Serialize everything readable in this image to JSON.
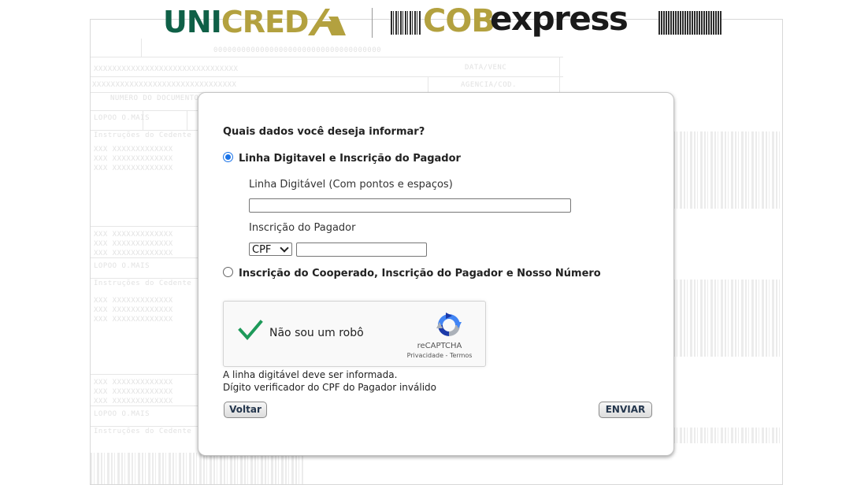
{
  "header": {
    "brand_left_part1": "UNI",
    "brand_left_part2": "CRED",
    "brand_right_part1": "COB",
    "brand_right_part2": "express"
  },
  "background": {
    "row1": "000000000000000000000000000000000000",
    "row2": "XXXXXXXXXXXXXXXXXXXXXXXXXXXXXXX",
    "row3": "DATA/VENC",
    "row4": "AGENCIA/COD.",
    "row5": "NUMERO DO DOCUMENTO",
    "row6": "LOPOO        O.MAIS",
    "row7": "XXX XXXXXXXXXXXXX",
    "row8": "Instruções do Cedente"
  },
  "form": {
    "question": "Quais dados você deseja informar?",
    "option1_label": "Linha Digitavel e Inscrição do Pagador",
    "option1_selected": true,
    "linha_label": "Linha Digitável (Com pontos e espaços)",
    "linha_value": "",
    "inscricao_label": "Inscrição do Pagador",
    "doc_type_selected": "CPF",
    "inscricao_value": "",
    "option2_label": "Inscrição do Cooperado, Inscrição do Pagador e Nosso Número",
    "option2_selected": false
  },
  "captcha": {
    "label": "Não sou um robô",
    "brand": "reCAPTCHA",
    "privacy": "Privacidade",
    "separator": " - ",
    "terms": "Termos",
    "checked": true,
    "check_color": "#1e9a5a"
  },
  "messages": {
    "error1": "A linha digitável deve ser informada.",
    "error2": "Dígito verificador do CPF do Pagador inválido"
  },
  "buttons": {
    "back": "Voltar",
    "submit": "ENVIAR"
  },
  "colors": {
    "unicred_green": "#0f6047",
    "brand_gold": "#b3a13f",
    "radio_blue": "#1a73e8"
  }
}
